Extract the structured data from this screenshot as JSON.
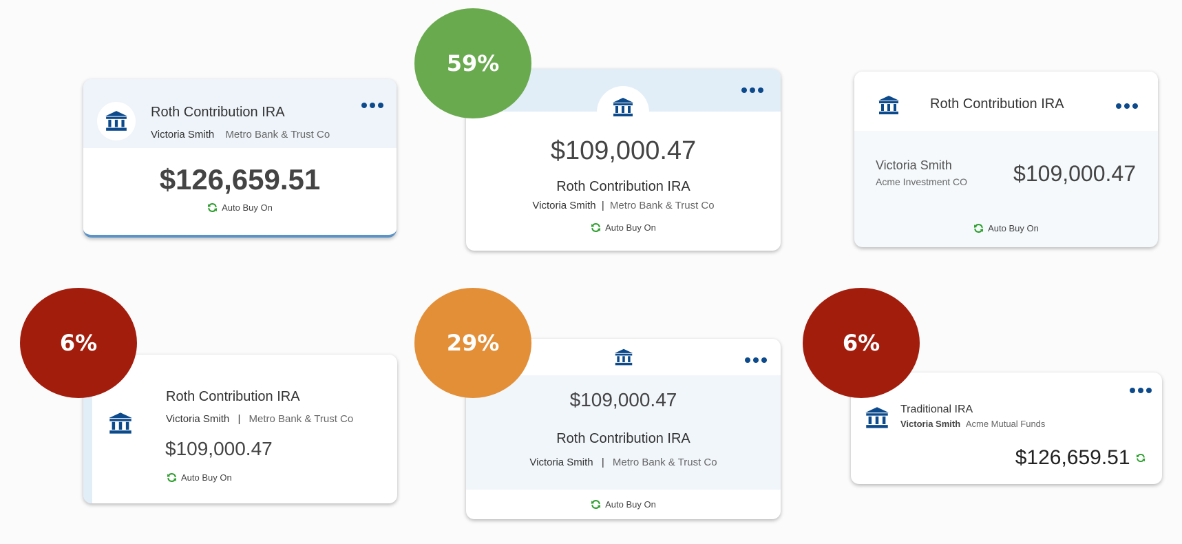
{
  "colors": {
    "accent": "#0c4a8c",
    "green": "#2e9e2e",
    "bubble_green": "#6aaa4e",
    "bubble_red": "#a31d0d",
    "bubble_orange": "#e38f37",
    "header_tint": "#eef4fa",
    "body_tint": "#f5f9fc"
  },
  "cards": [
    {
      "title": "Roth Contribution IRA",
      "owner": "Victoria Smith",
      "institution": "Metro Bank & Trust Co",
      "balance": "$126,659.51",
      "auto_buy": "Auto Buy On"
    },
    {
      "title": "Roth Contribution IRA",
      "owner": "Victoria Smith",
      "institution": "Metro Bank & Trust Co",
      "balance": "$109,000.47",
      "auto_buy": "Auto Buy On"
    },
    {
      "title": "Roth Contribution IRA",
      "owner": "Victoria Smith",
      "institution": "Acme Investment CO",
      "balance": "$109,000.47",
      "auto_buy": "Auto Buy On"
    },
    {
      "title": "Roth Contribution IRA",
      "owner": "Victoria Smith",
      "institution": "Metro Bank & Trust Co",
      "balance": "$109,000.47",
      "auto_buy": "Auto Buy On"
    },
    {
      "title": "Roth Contribution IRA",
      "owner": "Victoria Smith",
      "institution": "Metro Bank & Trust Co",
      "balance": "$109,000.47",
      "auto_buy": "Auto Buy On"
    },
    {
      "title": "Traditional IRA",
      "owner": "Victoria Smith",
      "institution": "Acme Mutual Funds",
      "balance": "$126,659.51"
    }
  ],
  "separators": {
    "pipe": "|"
  },
  "percentages": [
    "59%",
    "6%",
    "29%",
    "6%"
  ],
  "icons": {
    "bank": "bank-icon",
    "refresh": "refresh-icon",
    "more": "more-options-icon"
  }
}
